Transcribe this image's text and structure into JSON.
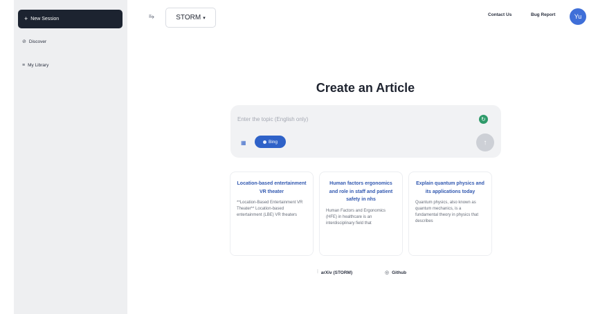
{
  "sidebar": {
    "new_session_label": "New Session",
    "new_session_icon": "+",
    "items": [
      {
        "label": "Discover",
        "icon": "compass-icon",
        "glyph": "⊘"
      },
      {
        "label": "My Library",
        "icon": "library-icon",
        "glyph": "≡"
      }
    ]
  },
  "header": {
    "toggle_glyph": "⥱",
    "model_selected": "STORM",
    "model_caret": "▾",
    "contact_label": "Contact Us",
    "bug_label": "Bug Report",
    "avatar_initials": "Yu"
  },
  "main": {
    "title": "Create an Article",
    "input_placeholder": "Enter the topic (English only)",
    "search_engine_label": "Bing",
    "send_glyph": "↑",
    "refresh_glyph": "↻",
    "grid_glyph": "▦"
  },
  "suggestions": [
    {
      "title": "Location-based entertainment VR theater",
      "snippet": "**Location-Based Entertainment VR Theater** Location-based entertainment (LBE) VR theaters"
    },
    {
      "title": "Human factors ergonomics and role in staff and patient safety in nhs",
      "snippet": "Human Factors and Ergonomics (HFE) in healthcare is an interdisciplinary field that"
    },
    {
      "title": "Explain quantum physics and its applications today",
      "snippet": "Quantum physics, also known as quantum mechanics, is a fundamental theory in physics that describes"
    }
  ],
  "footer": {
    "arxiv_label": "arXiv (STORM)",
    "arxiv_glyph": "⫶",
    "github_label": "Github",
    "github_glyph": "◎"
  },
  "colors": {
    "primary": "#2f62c8",
    "dark_button": "#1c2330",
    "sidebar_bg": "#eeeff1",
    "card_title": "#3158b0"
  }
}
